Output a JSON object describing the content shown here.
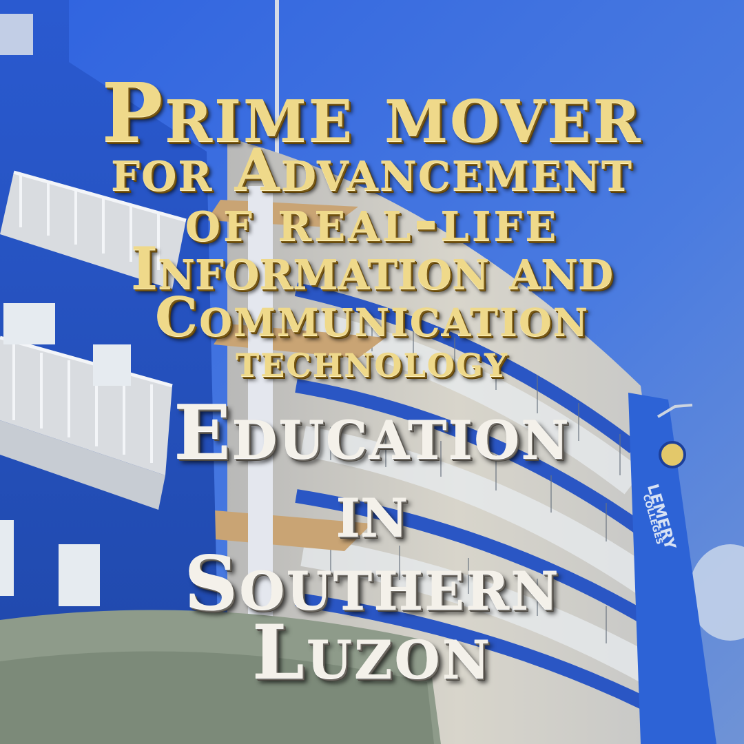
{
  "headline": {
    "line1": "Prime mover",
    "line2": "for Advancement",
    "line3": "of real-life",
    "line4": "Information and",
    "line5": "Communication",
    "line6": "technology",
    "line7": "Education",
    "line8": "in",
    "line9": "Southern",
    "line10": "Luzon"
  },
  "building_sign": {
    "name": "LEMERY",
    "subtitle": "COLLEGES"
  },
  "colors": {
    "sky": "#4a7be0",
    "building_blue": "#2f5fc8",
    "facade_cream": "#d9d6cc",
    "headline_gold": "#efd98a",
    "headline_silver": "#f4f1ea"
  }
}
